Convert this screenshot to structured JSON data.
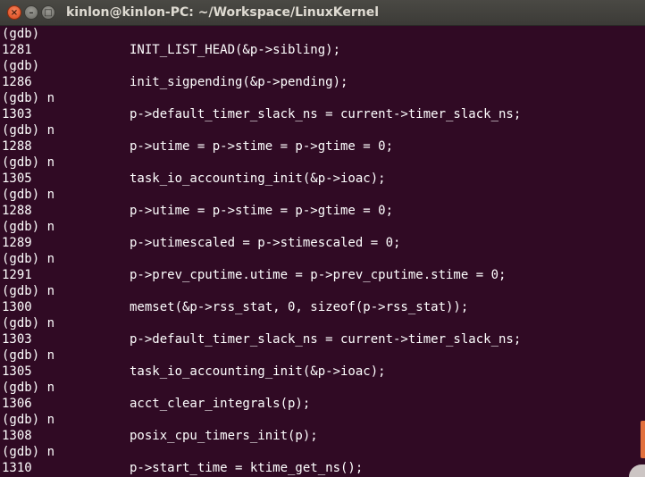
{
  "window": {
    "title": "kinlon@kinlon-PC: ~/Workspace/LinuxKernel",
    "close_glyph": "×",
    "minimize_glyph": "–",
    "maximize_glyph": "□"
  },
  "terminal": {
    "lines": [
      {
        "kind": "prompt",
        "text": "(gdb)"
      },
      {
        "kind": "src",
        "num": "1281",
        "code": "INIT_LIST_HEAD(&p->sibling);"
      },
      {
        "kind": "prompt",
        "text": "(gdb)"
      },
      {
        "kind": "src",
        "num": "1286",
        "code": "init_sigpending(&p->pending);"
      },
      {
        "kind": "prompt",
        "text": "(gdb) n"
      },
      {
        "kind": "src",
        "num": "1303",
        "code": "p->default_timer_slack_ns = current->timer_slack_ns;"
      },
      {
        "kind": "prompt",
        "text": "(gdb) n"
      },
      {
        "kind": "src",
        "num": "1288",
        "code": "p->utime = p->stime = p->gtime = 0;"
      },
      {
        "kind": "prompt",
        "text": "(gdb) n"
      },
      {
        "kind": "src",
        "num": "1305",
        "code": "task_io_accounting_init(&p->ioac);"
      },
      {
        "kind": "prompt",
        "text": "(gdb) n"
      },
      {
        "kind": "src",
        "num": "1288",
        "code": "p->utime = p->stime = p->gtime = 0;"
      },
      {
        "kind": "prompt",
        "text": "(gdb) n"
      },
      {
        "kind": "src",
        "num": "1289",
        "code": "p->utimescaled = p->stimescaled = 0;"
      },
      {
        "kind": "prompt",
        "text": "(gdb) n"
      },
      {
        "kind": "src",
        "num": "1291",
        "code": "p->prev_cputime.utime = p->prev_cputime.stime = 0;"
      },
      {
        "kind": "prompt",
        "text": "(gdb) n"
      },
      {
        "kind": "src",
        "num": "1300",
        "code": "memset(&p->rss_stat, 0, sizeof(p->rss_stat));"
      },
      {
        "kind": "prompt",
        "text": "(gdb) n"
      },
      {
        "kind": "src",
        "num": "1303",
        "code": "p->default_timer_slack_ns = current->timer_slack_ns;"
      },
      {
        "kind": "prompt",
        "text": "(gdb) n"
      },
      {
        "kind": "src",
        "num": "1305",
        "code": "task_io_accounting_init(&p->ioac);"
      },
      {
        "kind": "prompt",
        "text": "(gdb) n"
      },
      {
        "kind": "src",
        "num": "1306",
        "code": "acct_clear_integrals(p);"
      },
      {
        "kind": "prompt",
        "text": "(gdb) n"
      },
      {
        "kind": "src",
        "num": "1308",
        "code": "posix_cpu_timers_init(p);"
      },
      {
        "kind": "prompt",
        "text": "(gdb) n"
      },
      {
        "kind": "src",
        "num": "1310",
        "code": "p->start_time = ktime_get_ns();"
      }
    ]
  },
  "colors": {
    "background": "#300a24",
    "text": "#ffffff",
    "titlebar": "#3c3b37",
    "title_text": "#dfdbd2",
    "close_button": "#e95420",
    "scroll_accent": "#e2703d"
  },
  "icons": {
    "close": "close-icon",
    "minimize": "minimize-icon",
    "maximize": "maximize-icon"
  }
}
